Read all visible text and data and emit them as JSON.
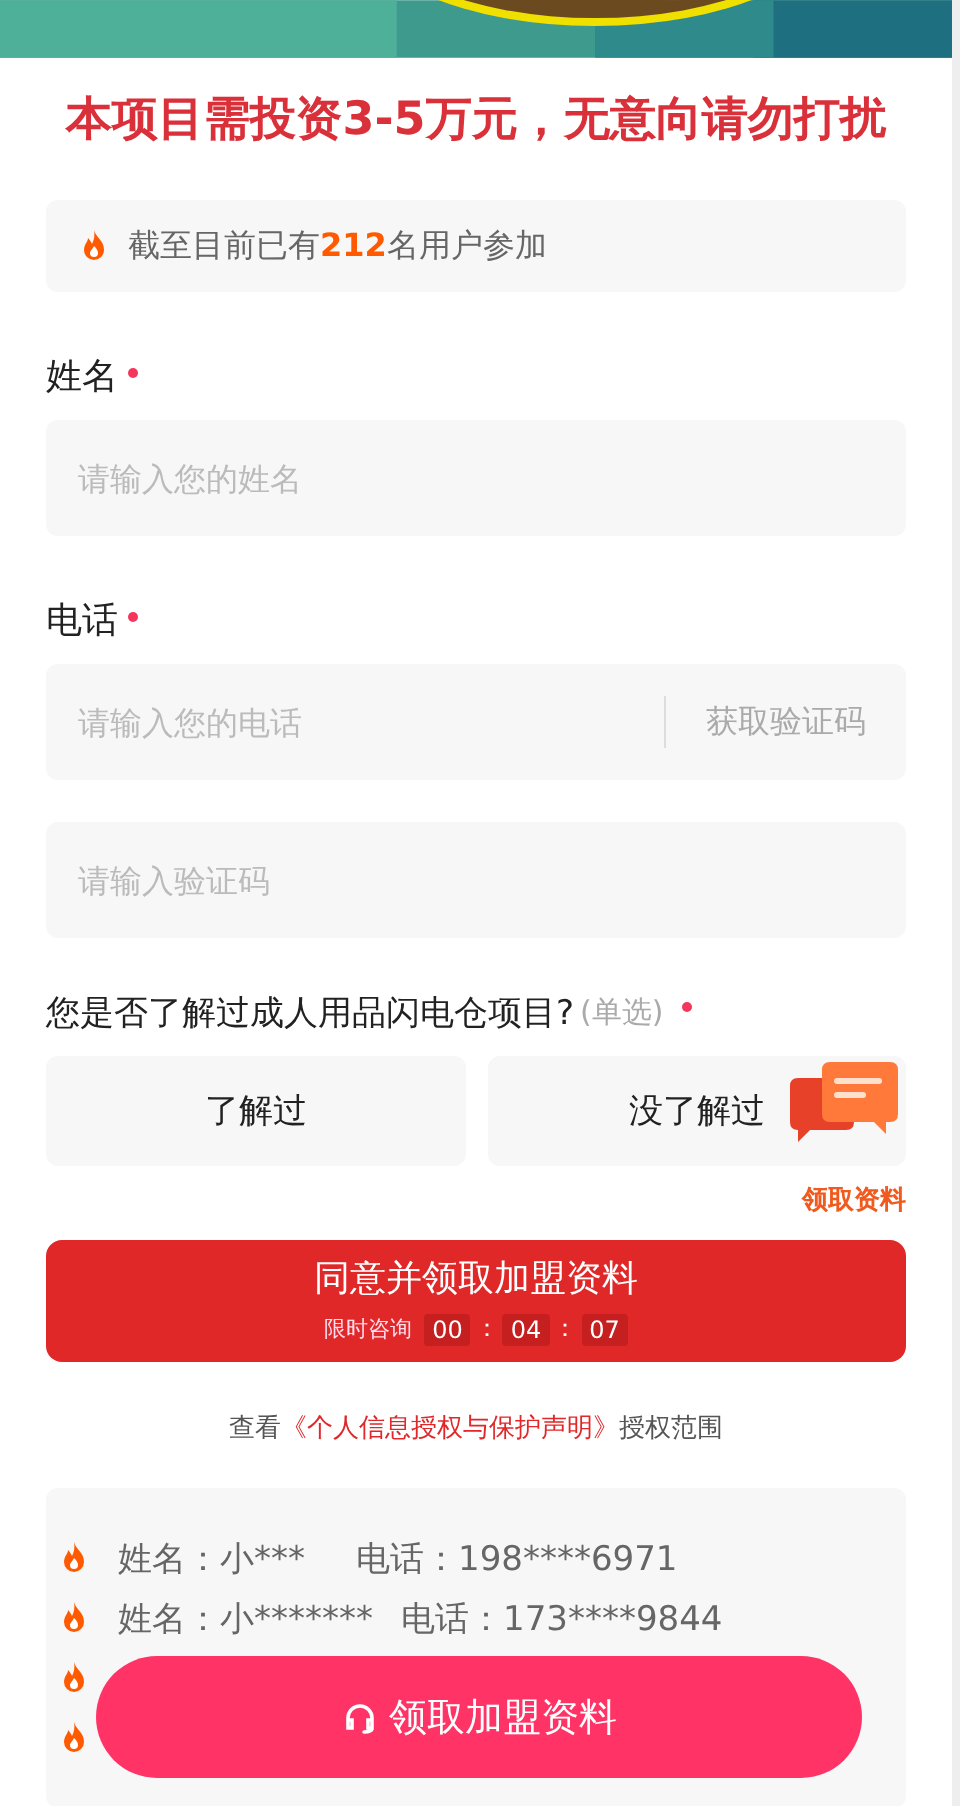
{
  "headline": "本项目需投资3-5万元，无意向请勿打扰",
  "stats": "截至目前已有**212**名用户参加",
  "fields": [
    {
      "kind": "text",
      "label": "姓名",
      "required": true,
      "placeholder": "请输入您的姓名"
    },
    {
      "kind": "phone",
      "label": "电话",
      "required": true,
      "placeholder": "请输入您的电话",
      "action": "获取验证码"
    },
    {
      "kind": "code",
      "placeholder": "请输入验证码"
    }
  ],
  "question": {
    "text": "您是否了解过成人用品闪电仓项目?",
    "hint": "(单选)",
    "required": true,
    "options": [
      {
        "label": "了解过",
        "selected": false
      },
      {
        "label": "没了解过",
        "selected": false
      }
    ]
  },
  "chat_badge": {
    "label": "领取资料"
  },
  "submit": {
    "label": "同意并领取加盟资料",
    "countdown_label": "限时咨询",
    "countdown": [
      {
        "kind": "digits",
        "text": "00"
      },
      {
        "kind": "colon",
        "text": "："
      },
      {
        "kind": "digits",
        "text": "04"
      },
      {
        "kind": "colon",
        "text": "："
      },
      {
        "kind": "digits",
        "text": "07"
      }
    ]
  },
  "agreement": {
    "before": "查看",
    "link": "《个人信息授权与保护声明》",
    "after": "授权范围"
  },
  "records": [
    {
      "kind": "entry",
      "name": "姓名：小***",
      "phone": "电话：198****6971"
    },
    {
      "kind": "entry",
      "name": "姓名：小*******",
      "phone": "电话：173****9844"
    },
    {
      "kind": "covered"
    },
    {
      "kind": "covered"
    }
  ],
  "float_button": {
    "label": "领取加盟资料"
  }
}
